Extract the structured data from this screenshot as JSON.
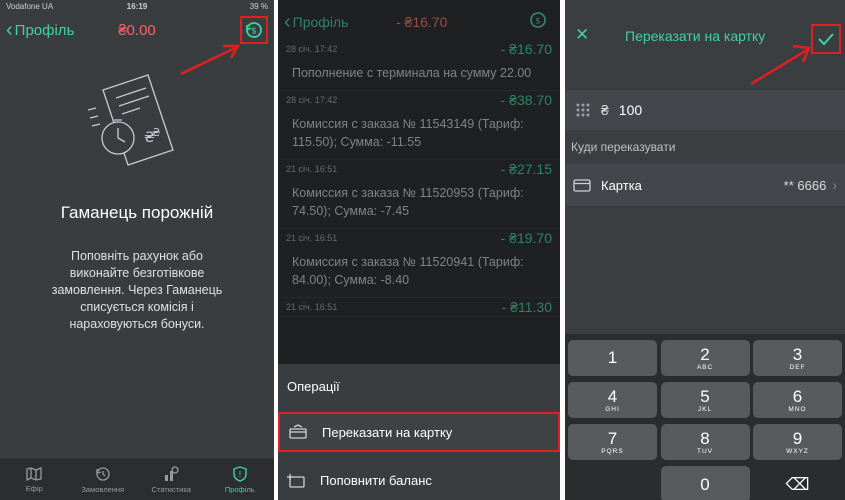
{
  "colors": {
    "accent": "#3dd39b",
    "negative": "#ff6161",
    "highlight": "#e02020"
  },
  "panel1": {
    "status": {
      "carrier": "Vodafone UA",
      "time": "16:19",
      "battery": "39 %"
    },
    "nav": {
      "back_label": "Профіль",
      "balance": "₴0.00"
    },
    "empty": {
      "title": "Гаманець порожній",
      "text": "Поповніть рахунок або виконайте безготівкове замовлення. Через Гаманець списується комісія і нараховуються бонуси."
    },
    "tabs": [
      {
        "label": "Ефір",
        "icon": "map-icon"
      },
      {
        "label": "Замовлення",
        "icon": "orders-icon"
      },
      {
        "label": "Статистика",
        "icon": "stats-icon"
      },
      {
        "label": "Профіль",
        "icon": "shield-icon"
      }
    ]
  },
  "panel2": {
    "nav": {
      "back_label": "Профіль",
      "balance": "- ₴16.70"
    },
    "transactions": [
      {
        "date": "28 січ. 17:42",
        "amount": "- ₴16.70",
        "desc": "Пополнение с терминала на сумму 22.00"
      },
      {
        "date": "28 січ. 17:42",
        "amount": "- ₴38.70",
        "desc": "Комиссия с заказа № 11543149 (Тариф: 115.50); Сумма: -11.55"
      },
      {
        "date": "21 січ. 16:51",
        "amount": "- ₴27.15",
        "desc": "Комиссия с заказа № 11520953 (Тариф: 74.50); Сумма: -7.45"
      },
      {
        "date": "21 січ. 16:51",
        "amount": "- ₴19.70",
        "desc": "Комиссия с заказа № 11520941 (Тариф: 84.00); Сумма: -8.40"
      },
      {
        "date": "21 січ. 16:51",
        "amount": "- ₴11.30",
        "desc": ""
      }
    ],
    "sheet": {
      "title": "Операції",
      "transfer_label": "Переказати на картку",
      "topup_label": "Поповнити баланс"
    }
  },
  "panel3": {
    "nav": {
      "title": "Переказати на картку"
    },
    "amount": {
      "currency": "₴",
      "value": "100"
    },
    "section_label": "Куди переказувати",
    "card": {
      "label": "Картка",
      "number": "** 6666"
    },
    "keypad": [
      [
        {
          "digit": "1",
          "letters": ""
        },
        {
          "digit": "2",
          "letters": "ABC"
        },
        {
          "digit": "3",
          "letters": "DEF"
        }
      ],
      [
        {
          "digit": "4",
          "letters": "GHI"
        },
        {
          "digit": "5",
          "letters": "JKL"
        },
        {
          "digit": "6",
          "letters": "MNO"
        }
      ],
      [
        {
          "digit": "7",
          "letters": "PQRS"
        },
        {
          "digit": "8",
          "letters": "TUV"
        },
        {
          "digit": "9",
          "letters": "WXYZ"
        }
      ],
      [
        {
          "digit": "",
          "letters": ""
        },
        {
          "digit": "0",
          "letters": ""
        },
        {
          "digit": "⌫",
          "letters": ""
        }
      ]
    ]
  }
}
